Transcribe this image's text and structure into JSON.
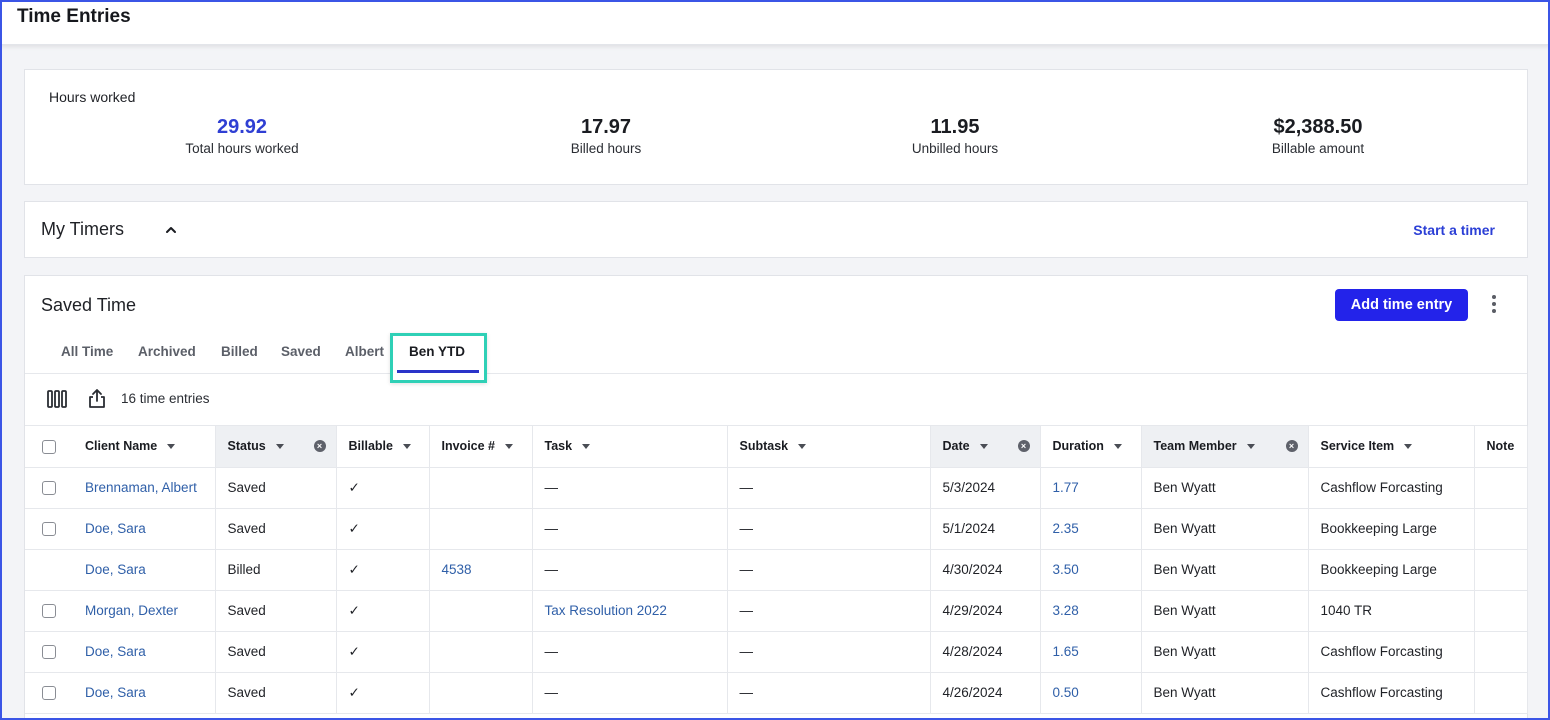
{
  "page": {
    "title": "Time Entries"
  },
  "hours": {
    "title": "Hours worked",
    "stats": [
      {
        "value": "29.92",
        "label": "Total hours worked"
      },
      {
        "value": "17.97",
        "label": "Billed hours"
      },
      {
        "value": "11.95",
        "label": "Unbilled hours"
      },
      {
        "value": "$2,388.50",
        "label": "Billable amount"
      }
    ]
  },
  "timers": {
    "title": "My Timers",
    "start_label": "Start a timer"
  },
  "saved": {
    "title": "Saved Time",
    "add_label": "Add time entry",
    "tabs": [
      "All Time",
      "Archived",
      "Billed",
      "Saved",
      "Albert",
      "Ben YTD"
    ],
    "active_tab": "Ben YTD",
    "entry_count": "16 time entries"
  },
  "table": {
    "columns": [
      "Client Name",
      "Status",
      "Billable",
      "Invoice #",
      "Task",
      "Subtask",
      "Date",
      "Duration",
      "Team Member",
      "Service Item",
      "Note"
    ],
    "rows": [
      {
        "client": "Brennaman, Albert",
        "status": "Saved",
        "billable": "✓",
        "invoice": "",
        "task": "—",
        "subtask": "—",
        "date": "5/3/2024",
        "duration": "1.77",
        "member": "Ben Wyatt",
        "service": "Cashflow Forcasting",
        "checkbox": true
      },
      {
        "client": "Doe, Sara",
        "status": "Saved",
        "billable": "✓",
        "invoice": "",
        "task": "—",
        "subtask": "—",
        "date": "5/1/2024",
        "duration": "2.35",
        "member": "Ben Wyatt",
        "service": "Bookkeeping Large",
        "checkbox": true
      },
      {
        "client": "Doe, Sara",
        "status": "Billed",
        "billable": "✓",
        "invoice": "4538",
        "task": "—",
        "subtask": "—",
        "date": "4/30/2024",
        "duration": "3.50",
        "member": "Ben Wyatt",
        "service": "Bookkeeping Large",
        "checkbox": false
      },
      {
        "client": "Morgan, Dexter",
        "status": "Saved",
        "billable": "✓",
        "invoice": "",
        "task": "Tax Resolution 2022",
        "subtask": "—",
        "date": "4/29/2024",
        "duration": "3.28",
        "member": "Ben Wyatt",
        "service": "1040 TR",
        "checkbox": true
      },
      {
        "client": "Doe, Sara",
        "status": "Saved",
        "billable": "✓",
        "invoice": "",
        "task": "—",
        "subtask": "—",
        "date": "4/28/2024",
        "duration": "1.65",
        "member": "Ben Wyatt",
        "service": "Cashflow Forcasting",
        "checkbox": true
      },
      {
        "client": "Doe, Sara",
        "status": "Saved",
        "billable": "✓",
        "invoice": "",
        "task": "—",
        "subtask": "—",
        "date": "4/26/2024",
        "duration": "0.50",
        "member": "Ben Wyatt",
        "service": "Cashflow Forcasting",
        "checkbox": true
      }
    ]
  },
  "colors": {
    "accent": "#2323ea",
    "link": "#2f5fa8",
    "highlight": "#2fd0b6",
    "total_value": "#2f3fd3"
  }
}
